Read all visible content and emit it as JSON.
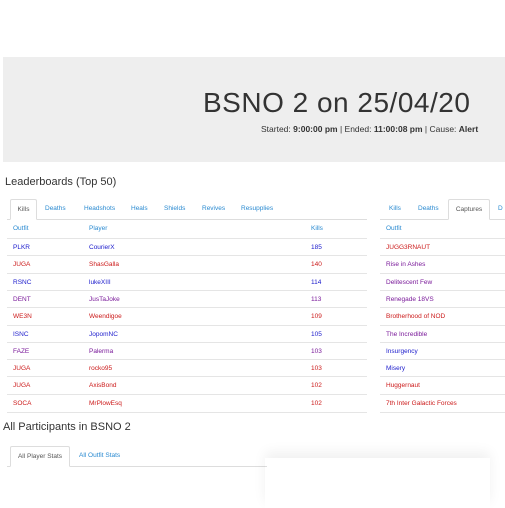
{
  "hero": {
    "title": "BSNO 2 on 25/04/20",
    "started_label": "Started:",
    "started_value": "9:00:00 pm",
    "ended_label": "Ended:",
    "ended_value": "11:00:08 pm",
    "cause_label": "Cause:",
    "cause_value": "Alert"
  },
  "leaderboards": {
    "title": "Leaderboards (Top 50)",
    "left_tabs": [
      "Kills",
      "Deaths",
      "Headshots",
      "Heals",
      "Shields",
      "Revives",
      "Resupplies"
    ],
    "right_tabs": [
      "Kills",
      "Deaths",
      "Captures",
      "D"
    ],
    "left_headers": {
      "outfit": "Outfit",
      "player": "Player",
      "kills": "Kills"
    },
    "right_headers": {
      "outfit": "Outfit"
    },
    "rows": [
      {
        "outfit": "PLKR",
        "player": "CourierX",
        "kills": "185",
        "color": "#1a1acc"
      },
      {
        "outfit": "JUGA",
        "player": "ShasGalla",
        "kills": "140",
        "color": "#cc1a1a"
      },
      {
        "outfit": "RSNC",
        "player": "lukeXIII",
        "kills": "114",
        "color": "#1a1acc"
      },
      {
        "outfit": "DENT",
        "player": "JusTaJoke",
        "kills": "113",
        "color": "#7a1a9a"
      },
      {
        "outfit": "WE3N",
        "player": "Weendigoe",
        "kills": "109",
        "color": "#cc1a1a"
      },
      {
        "outfit": "ISNC",
        "player": "JopomNC",
        "kills": "105",
        "color": "#1a1acc"
      },
      {
        "outfit": "FAZE",
        "player": "Palerma",
        "kills": "103",
        "color": "#7a1a9a"
      },
      {
        "outfit": "JUGA",
        "player": "rocko95",
        "kills": "103",
        "color": "#cc1a1a"
      },
      {
        "outfit": "JUGA",
        "player": "AxisBond",
        "kills": "102",
        "color": "#cc1a1a"
      },
      {
        "outfit": "SOCA",
        "player": "MrPlowEsq",
        "kills": "102",
        "color": "#cc1a1a"
      }
    ],
    "right_rows": [
      {
        "outfit": "JUGG3RNAUT",
        "color": "#cc1a1a"
      },
      {
        "outfit": "Rise in Ashes",
        "color": "#7a1a9a"
      },
      {
        "outfit": "Delitescent Few",
        "color": "#7a1a9a"
      },
      {
        "outfit": "Renegade 18VS",
        "color": "#7a1a9a"
      },
      {
        "outfit": "Brotherhood of NOD",
        "color": "#cc1a1a"
      },
      {
        "outfit": "The Incredible",
        "color": "#7a1a9a"
      },
      {
        "outfit": "Insurgency",
        "color": "#1a1acc"
      },
      {
        "outfit": "Misery",
        "color": "#1a1acc"
      },
      {
        "outfit": "Huggernaut",
        "color": "#cc1a1a"
      },
      {
        "outfit": "7th Inter Galactic Forces",
        "color": "#cc1a1a"
      }
    ]
  },
  "participants": {
    "title": "All Participants in BSNO 2",
    "tabs": [
      "All Player Stats",
      "All Outfit Stats"
    ]
  }
}
